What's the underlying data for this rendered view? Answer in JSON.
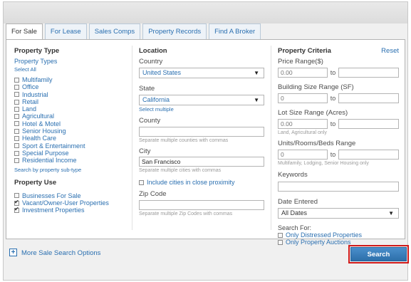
{
  "tabs": [
    "For Sale",
    "For Lease",
    "Sales Comps",
    "Property Records",
    "Find A Broker"
  ],
  "property_type": {
    "title": "Property Type",
    "subtitle": "Property Types",
    "select_all": "Select All",
    "items": [
      {
        "label": "Multifamily",
        "checked": false
      },
      {
        "label": "Office",
        "checked": false
      },
      {
        "label": "Industrial",
        "checked": false
      },
      {
        "label": "Retail",
        "checked": false
      },
      {
        "label": "Land",
        "checked": false
      },
      {
        "label": "Agricultural",
        "checked": false
      },
      {
        "label": "Hotel & Motel",
        "checked": false
      },
      {
        "label": "Senior Housing",
        "checked": false
      },
      {
        "label": "Health Care",
        "checked": false
      },
      {
        "label": "Sport & Entertainment",
        "checked": false
      },
      {
        "label": "Special Purpose",
        "checked": false
      },
      {
        "label": "Residential Income",
        "checked": false
      }
    ],
    "subtype_link": "Search by property sub-type"
  },
  "property_use": {
    "title": "Property Use",
    "items": [
      {
        "label": "Businesses For Sale",
        "checked": false
      },
      {
        "label": "Vacant/Owner-User Properties",
        "checked": true
      },
      {
        "label": "Investment Properties",
        "checked": true
      }
    ]
  },
  "location": {
    "title": "Location",
    "country_label": "Country",
    "country_value": "United States",
    "state_label": "State",
    "state_value": "California",
    "select_multiple": "Select multiple",
    "county_label": "County",
    "county_value": "",
    "county_hint": "Separate multiple counties with commas",
    "city_label": "City",
    "city_value": "San Francisco",
    "city_hint": "Separate multiple cities with commas",
    "proximity_label": "Include cities in close proximity",
    "zip_label": "Zip Code",
    "zip_value": "",
    "zip_hint": "Separate multiple Zip Codes with commas"
  },
  "criteria": {
    "title": "Property Criteria",
    "reset": "Reset",
    "price_label": "Price Range($)",
    "price_min_placeholder": "0.00",
    "building_label": "Building Size Range (SF)",
    "building_min_placeholder": "0",
    "lot_label": "Lot Size Range (Acres)",
    "lot_min_placeholder": "0.00",
    "lot_hint": "Land, Agricultural only",
    "units_label": "Units/Rooms/Beds Range",
    "units_min_placeholder": "0",
    "units_hint": "Multifamily, Lodging, Senior Housing only",
    "to": "to",
    "keywords_label": "Keywords",
    "date_label": "Date Entered",
    "date_value": "All Dates",
    "search_for_label": "Search For:",
    "search_for_items": [
      {
        "label": "Only Distressed Properties",
        "checked": false
      },
      {
        "label": "Only Property Auctions",
        "checked": false
      }
    ]
  },
  "footer": {
    "plus": "+",
    "more_options": "More Sale Search Options",
    "search_button": "Search"
  },
  "icons": {
    "dropdown": "chevron-down-icon",
    "expand": "plus-icon"
  }
}
